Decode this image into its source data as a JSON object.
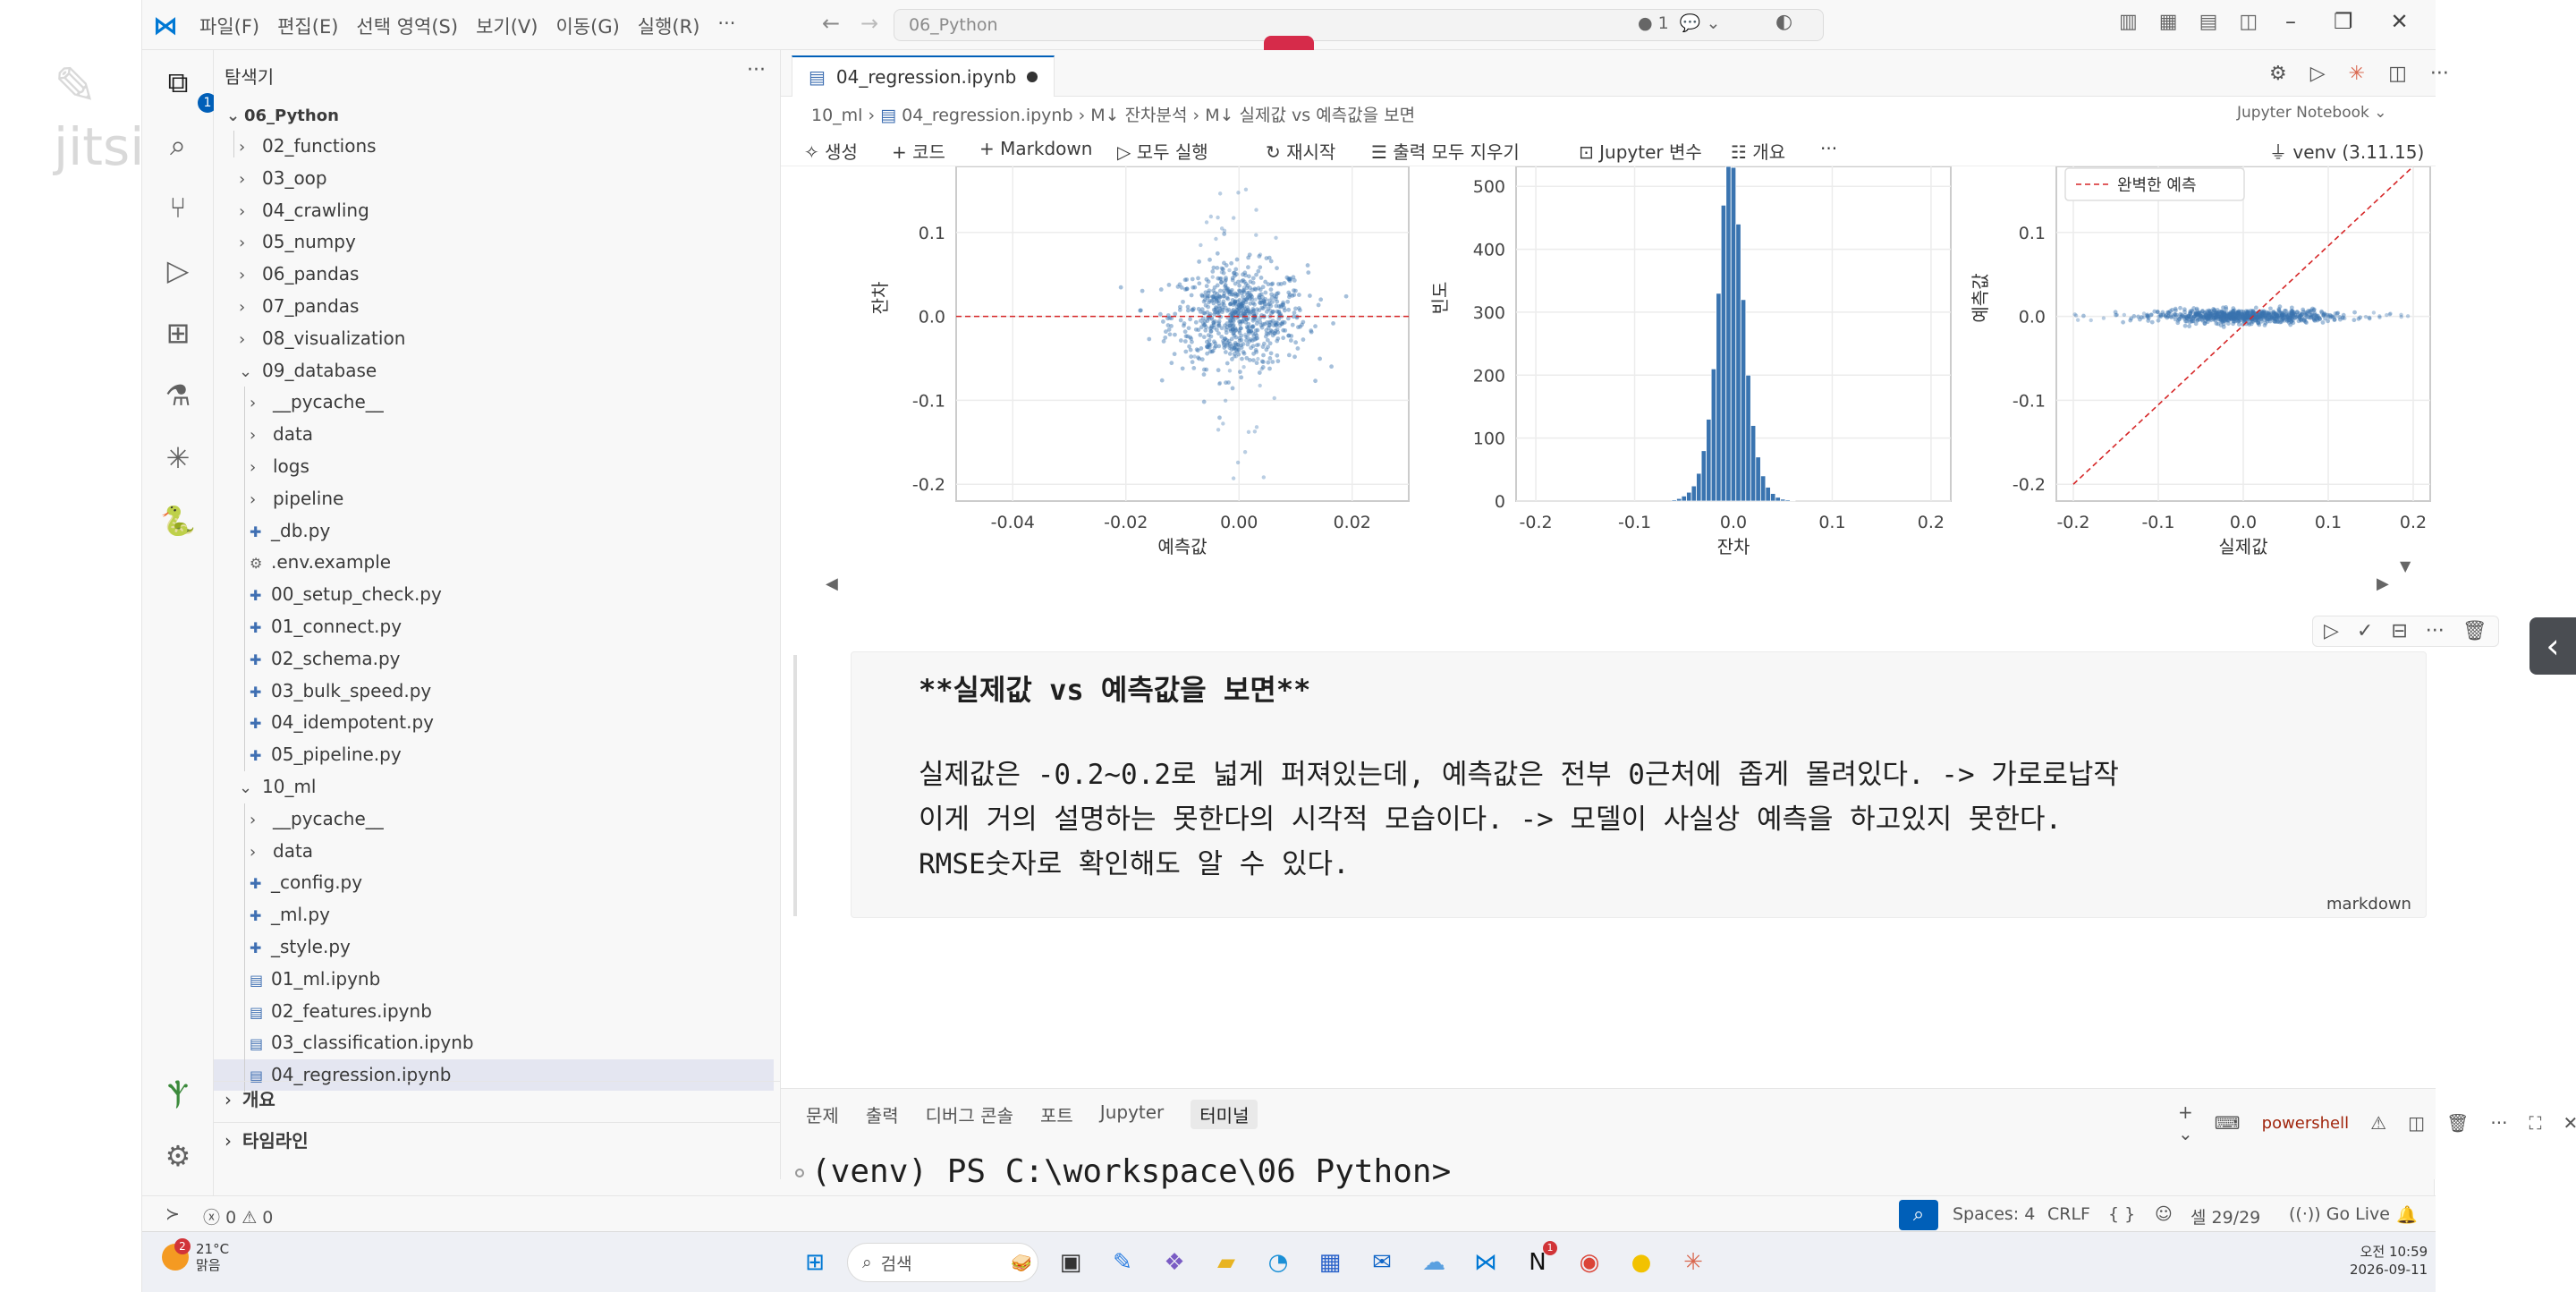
{
  "overlay": {
    "logo_text": "jitsi"
  },
  "titlebar": {
    "menus": [
      "파일(F)",
      "편집(E)",
      "선택 영역(S)",
      "보기(V)",
      "이동(G)",
      "실행(R)",
      "···"
    ],
    "search_text": "06_Python",
    "count_badge": "1"
  },
  "activity": {
    "explorer_badge": "1"
  },
  "sidebar": {
    "title": "탐색기",
    "root": "06_Python",
    "items": [
      {
        "label": "02_functions",
        "kind": "folder",
        "depth": 1,
        "open": false
      },
      {
        "label": "03_oop",
        "kind": "folder",
        "depth": 1,
        "open": false
      },
      {
        "label": "04_crawling",
        "kind": "folder",
        "depth": 1,
        "open": false
      },
      {
        "label": "05_numpy",
        "kind": "folder",
        "depth": 1,
        "open": false
      },
      {
        "label": "06_pandas",
        "kind": "folder",
        "depth": 1,
        "open": false
      },
      {
        "label": "07_pandas",
        "kind": "folder",
        "depth": 1,
        "open": false
      },
      {
        "label": "08_visualization",
        "kind": "folder",
        "depth": 1,
        "open": false
      },
      {
        "label": "09_database",
        "kind": "folder",
        "depth": 1,
        "open": true
      },
      {
        "label": "__pycache__",
        "kind": "folder",
        "depth": 2,
        "open": false
      },
      {
        "label": "data",
        "kind": "folder",
        "depth": 2,
        "open": false
      },
      {
        "label": "logs",
        "kind": "folder",
        "depth": 2,
        "open": false
      },
      {
        "label": "pipeline",
        "kind": "folder",
        "depth": 2,
        "open": false
      },
      {
        "label": "_db.py",
        "kind": "py",
        "depth": 2
      },
      {
        "label": ".env.example",
        "kind": "gear",
        "depth": 2
      },
      {
        "label": "00_setup_check.py",
        "kind": "py",
        "depth": 2
      },
      {
        "label": "01_connect.py",
        "kind": "py",
        "depth": 2
      },
      {
        "label": "02_schema.py",
        "kind": "py",
        "depth": 2
      },
      {
        "label": "03_bulk_speed.py",
        "kind": "py",
        "depth": 2
      },
      {
        "label": "04_idempotent.py",
        "kind": "py",
        "depth": 2
      },
      {
        "label": "05_pipeline.py",
        "kind": "py",
        "depth": 2
      },
      {
        "label": "10_ml",
        "kind": "folder",
        "depth": 1,
        "open": true
      },
      {
        "label": "__pycache__",
        "kind": "folder",
        "depth": 2,
        "open": false
      },
      {
        "label": "data",
        "kind": "folder",
        "depth": 2,
        "open": false
      },
      {
        "label": "_config.py",
        "kind": "py",
        "depth": 2
      },
      {
        "label": "_ml.py",
        "kind": "py",
        "depth": 2
      },
      {
        "label": "_style.py",
        "kind": "py",
        "depth": 2
      },
      {
        "label": "01_ml.ipynb",
        "kind": "nb",
        "depth": 2
      },
      {
        "label": "02_features.ipynb",
        "kind": "nb",
        "depth": 2
      },
      {
        "label": "03_classification.ipynb",
        "kind": "nb",
        "depth": 2
      },
      {
        "label": "04_regression.ipynb",
        "kind": "nb",
        "depth": 2,
        "selected": true
      }
    ],
    "sections": [
      "개요",
      "타임라인"
    ]
  },
  "editor": {
    "tab_label": "04_regression.ipynb",
    "breadcrumbs": [
      "10_ml",
      "04_regression.ipynb",
      "M↓ 잔차분석",
      "M↓ 실제값 vs 예측값을 보면"
    ],
    "notebook_type": "Jupyter Notebook",
    "toolbar": [
      "생성",
      "코드",
      "Markdown",
      "모두 실행",
      "재시작",
      "출력 모두 지우기",
      "Jupyter 변수",
      "개요",
      "···"
    ],
    "kernel": "venv (3.11.15) (Python 3.11.15)"
  },
  "chart_data": [
    {
      "type": "scatter",
      "xlabel": "예측값",
      "ylabel": "잔차",
      "xlim": [
        -0.05,
        0.03
      ],
      "ylim": [
        -0.22,
        0.2
      ],
      "x_ticks": [
        "-0.04",
        "-0.02",
        "0.00",
        "0.02"
      ],
      "y_ticks": [
        "0.2",
        "0.1",
        "0.0",
        "-0.1",
        "-0.2"
      ],
      "reference_line": {
        "y": 0.0,
        "style": "dashed",
        "color": "#d62728"
      },
      "cluster": {
        "x_center": 0.0,
        "y_center": 0.0,
        "x_spread": 0.006,
        "y_spread": 0.03
      }
    },
    {
      "type": "bar",
      "xlabel": "잔차",
      "ylabel": "빈도",
      "xlim": [
        -0.22,
        0.22
      ],
      "ylim": [
        0,
        560
      ],
      "x_ticks": [
        "-0.2",
        "-0.1",
        "0.0",
        "0.1",
        "0.2"
      ],
      "y_ticks": [
        "500",
        "400",
        "300",
        "200",
        "100",
        "0"
      ],
      "bins_x": [
        -0.06,
        -0.055,
        -0.05,
        -0.045,
        -0.04,
        -0.035,
        -0.03,
        -0.025,
        -0.02,
        -0.015,
        -0.01,
        -0.005,
        0.0,
        0.005,
        0.01,
        0.015,
        0.02,
        0.025,
        0.03,
        0.035,
        0.04,
        0.045,
        0.05,
        0.055,
        0.06
      ],
      "values": [
        2,
        4,
        8,
        14,
        24,
        44,
        80,
        130,
        210,
        330,
        470,
        560,
        530,
        440,
        320,
        200,
        120,
        70,
        40,
        22,
        12,
        6,
        3,
        2,
        1
      ]
    },
    {
      "type": "scatter",
      "xlabel": "실제값",
      "ylabel": "예측값",
      "xlim": [
        -0.22,
        0.22
      ],
      "ylim": [
        -0.22,
        0.2
      ],
      "x_ticks": [
        "-0.2",
        "-0.1",
        "0.0",
        "0.1",
        "0.2"
      ],
      "y_ticks": [
        "0.2",
        "0.1",
        "0.0",
        "-0.1",
        "-0.2"
      ],
      "legend": [
        "완벽한 예측"
      ],
      "legend_position": "top-left",
      "reference_line": {
        "from": [
          -0.2,
          -0.2
        ],
        "to": [
          0.2,
          0.2
        ],
        "style": "dashed",
        "color": "#d62728"
      },
      "cluster": {
        "x_center": 0.0,
        "y_center": 0.0,
        "x_spread": 0.05,
        "y_spread": 0.004
      }
    }
  ],
  "markdown_cell": {
    "heading": "**실제값 vs 예측값을 보면**",
    "lines": [
      "실제값은 -0.2~0.2로 넓게 퍼져있는데, 예측값은 전부 0근처에 좁게 몰려있다. -> 가로로납작",
      "이게 거의 설명하는 못한다의 시각적 모습이다. -> 모델이 사실상 예측을 하고있지 못한다.",
      "RMSE숫자로 확인해도 알 수 있다."
    ],
    "tag": "markdown"
  },
  "panel": {
    "tabs": [
      "문제",
      "출력",
      "디버그 콘솔",
      "포트",
      "Jupyter",
      "터미널"
    ],
    "active_tab": "터미널",
    "shell": "powershell",
    "terminal_prompt": "(venv) PS C:\\workspace\\06 Python>"
  },
  "statusbar": {
    "errors": "0",
    "warnings": "0",
    "spaces": "Spaces: 4",
    "eol": "CRLF",
    "braces": "{ }",
    "cell": "셀 29/29",
    "golive": "Go Live"
  },
  "taskbar": {
    "weather_temp": "21°C",
    "weather_desc": "맑음",
    "weather_badge": "2",
    "search_label": "검색",
    "time": "오전 10:59",
    "date": "2026-09-11",
    "notion_badge": "1"
  },
  "colors": {
    "accent": "#005fb8",
    "plot_blue": "#3a74b0",
    "ref_red": "#d62728",
    "record": "#d62b4a"
  }
}
